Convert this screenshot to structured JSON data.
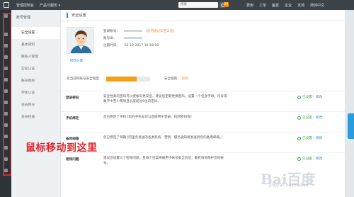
{
  "topbar": {
    "nav": [
      "管理控制台",
      "产品与服务 ▾"
    ],
    "search_placeholder": "搜索",
    "message_count": "29",
    "right_items": [
      "费用",
      "工单",
      "备案",
      "企业",
      "支持",
      "简体中文"
    ]
  },
  "subnav": {
    "title": "账号管理",
    "items": [
      "安全设置",
      "基本资料",
      "联系人管理",
      "实名认证",
      "账号授权",
      "学生认证",
      "会员积分",
      "会员权益"
    ],
    "active_index": 0
  },
  "main": {
    "title": "安全设置",
    "profile": {
      "login_label": "登录账号：",
      "login_hint": "(您已通过实名认证)",
      "id_label": "账号ID：",
      "reg_label": "注册时间：",
      "reg_time": "10-19-2017 19:18:00",
      "avatar_link": "修改头像"
    },
    "security_level": {
      "label": "您当前的账号安全程度",
      "level_label": "安全级别：",
      "level_value": "较高",
      "progress_fraction": 0.7
    },
    "rows": [
      {
        "name": "登录密码",
        "desc": "安全性高的密码可以使帐号更安全。建议您定期更换密码，设置一个包含字母，符号或数字中至少两项且长度超过6位的密码。",
        "status": "已设置",
        "action": "修改"
      },
      {
        "name": "手机绑定",
        "desc": "您已绑定了手机 [您的手机号可以直接用于登录、找回密码等]",
        "status": "已设置",
        "action": "修改"
      },
      {
        "name": "备用邮箱",
        "desc": "您已绑定了邮箱 [阿里云发送的各类系统、营销、服务通知将发送到您的备用邮箱。]",
        "status": "已设置",
        "action": "修改"
      },
      {
        "name": "密保问题",
        "desc": "建议您设置三个密保问题，且每个答案将被用于帐号安全验证，最有效地保护您的帐号。",
        "status": "已设置",
        "action": "修改"
      }
    ]
  },
  "annotation": "鼠标移动到这里",
  "watermark": {
    "brand": "Bai百度",
    "sub": "jingyan.baidu.com"
  },
  "colors": {
    "accent": "#1e88d8",
    "warning": "#f08a1a",
    "success": "#41a94b",
    "annotation": "#e0262b",
    "topbar": "#3b4248"
  }
}
